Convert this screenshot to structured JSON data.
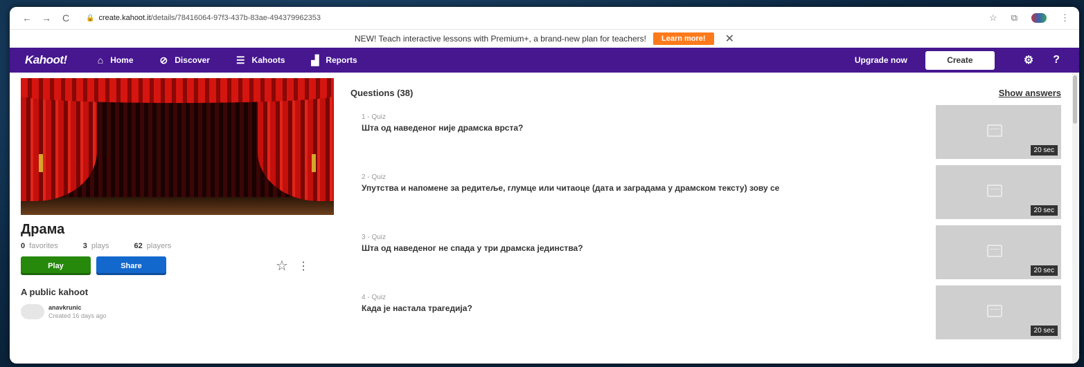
{
  "browser": {
    "url_host": "create.kahoot.it",
    "url_path": "/details/78416064-97f3-437b-83ae-494379962353",
    "back_icon": "←",
    "forward_icon": "→",
    "reload_icon": "C",
    "lock_icon": "🔒",
    "star_icon": "☆",
    "extension_icon": "⧉",
    "menu_icon": "⋮"
  },
  "announcement": {
    "text": "NEW! Teach interactive lessons with Premium+, a brand-new plan for teachers!",
    "button": "Learn more!",
    "close": "✕"
  },
  "nav": {
    "logo": "Kahoot!",
    "items": [
      {
        "label": "Home",
        "icon": "⌂"
      },
      {
        "label": "Discover",
        "icon": "⊘"
      },
      {
        "label": "Kahoots",
        "icon": "☰"
      },
      {
        "label": "Reports",
        "icon": "▟"
      }
    ],
    "upgrade": "Upgrade now",
    "create": "Create",
    "settings_icon": "⚙",
    "help_icon": "?"
  },
  "kahoot": {
    "title": "Драма",
    "favorites_count": "0",
    "favorites_label": "favorites",
    "plays_count": "3",
    "plays_label": "plays",
    "players_count": "62",
    "players_label": "players",
    "play_button": "Play",
    "share_button": "Share",
    "favorite_icon": "☆",
    "more_icon": "⋮",
    "visibility": "A public kahoot",
    "owner_name": "anavkrunic",
    "owner_created": "Created 16 days ago"
  },
  "questions": {
    "header": "Questions (38)",
    "show_answers": "Show answers",
    "items": [
      {
        "meta": "1 - Quiz",
        "text": "Шта од наведеног није драмска врста?",
        "time": "20 sec"
      },
      {
        "meta": "2 - Quiz",
        "text": "Упутства и напомене за редитеље, глумце или читаоце (дата и заградама у драмском тексту) зову се",
        "time": "20 sec"
      },
      {
        "meta": "3 - Quiz",
        "text": "Шта од наведеног не спада у три драмска јединства?",
        "time": "20 sec"
      },
      {
        "meta": "4 - Quiz",
        "text": "Када је настала трагедија?",
        "time": "20 sec"
      }
    ]
  },
  "colors": {
    "nav_purple": "#46178f",
    "play_green": "#26890c",
    "share_blue": "#1368ce",
    "learn_orange": "#ff7a1a"
  }
}
